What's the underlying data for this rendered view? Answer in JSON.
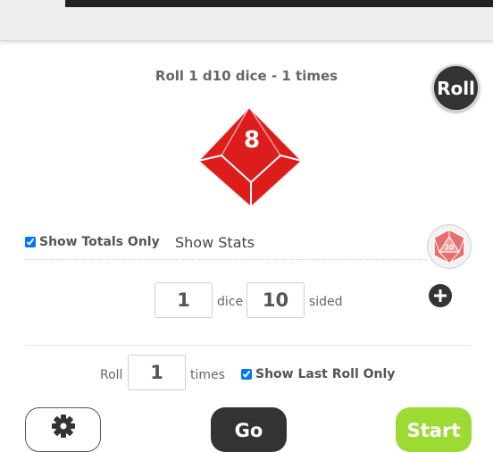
{
  "header": {
    "summary": "Roll 1 d10 dice - 1 times"
  },
  "roll_button": {
    "label": "Roll"
  },
  "die": {
    "value": "8",
    "color": "#dd1c1c"
  },
  "options": {
    "show_totals_only": {
      "label": "Show Totals Only",
      "checked": true
    },
    "show_stats": {
      "label": "Show Stats"
    },
    "show_last_roll_only": {
      "label": "Show Last Roll Only",
      "checked": true
    }
  },
  "dice_config": {
    "count_value": "1",
    "count_label": "dice",
    "sides_value": "10",
    "sides_label": "sided"
  },
  "repeat": {
    "prefix": "Roll",
    "times_value": "1",
    "suffix": "times"
  },
  "icons": {
    "d20_badge_text": "20",
    "settings_icon": "gear-icon",
    "add_icon": "plus-icon"
  },
  "buttons": {
    "go": "Go",
    "start": "Start"
  },
  "colors": {
    "accent_green": "#9ddb34",
    "dark": "#333333"
  }
}
